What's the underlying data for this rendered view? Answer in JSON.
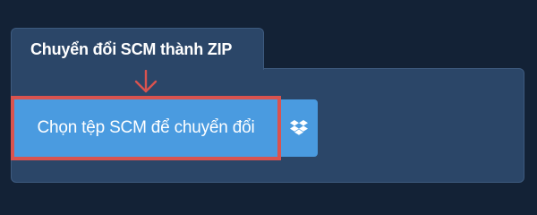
{
  "tab": {
    "title": "Chuyển đổi SCM thành ZIP"
  },
  "main": {
    "choose_file_label": "Chọn tệp SCM để chuyển đổi",
    "dropbox_icon": "dropbox-icon",
    "arrow_icon": "arrow-down-icon"
  },
  "colors": {
    "page_background": "#132236",
    "panel_background": "#2b4668",
    "button_background": "#4a9be0",
    "highlight": "#d9534f"
  }
}
